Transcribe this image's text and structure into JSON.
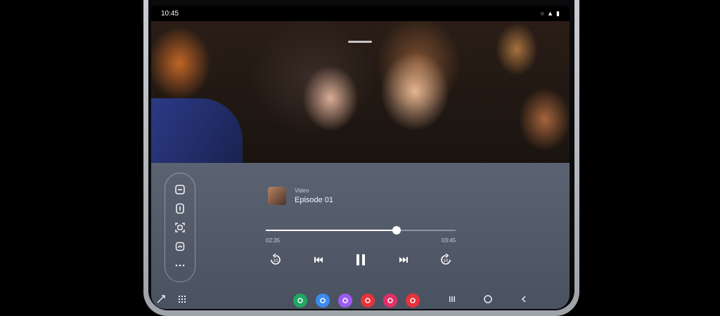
{
  "status_bar": {
    "time": "10:45"
  },
  "media": {
    "source": "Video",
    "title": "Episode 01",
    "elapsed": "02:35",
    "total": "03:45",
    "progress": 0.69
  },
  "side_panel": {
    "items": [
      "split-view-icon",
      "pip-icon",
      "screen-capture-icon",
      "screenshot-icon",
      "more-icon"
    ]
  },
  "taskbar": {
    "apps": [
      {
        "name": "phone-app-icon",
        "color": "#1fa862"
      },
      {
        "name": "messages-app-icon",
        "color": "#3c8bf0"
      },
      {
        "name": "chat-app-icon",
        "color": "#9c5cf0"
      },
      {
        "name": "flipboard-app-icon",
        "color": "#e8323a"
      },
      {
        "name": "gallery-app-icon",
        "color": "#e0306a"
      },
      {
        "name": "youtube-app-icon",
        "color": "#e8323a"
      }
    ]
  },
  "colors": {
    "panel": "#4f5766",
    "accent": "#ffffff"
  }
}
